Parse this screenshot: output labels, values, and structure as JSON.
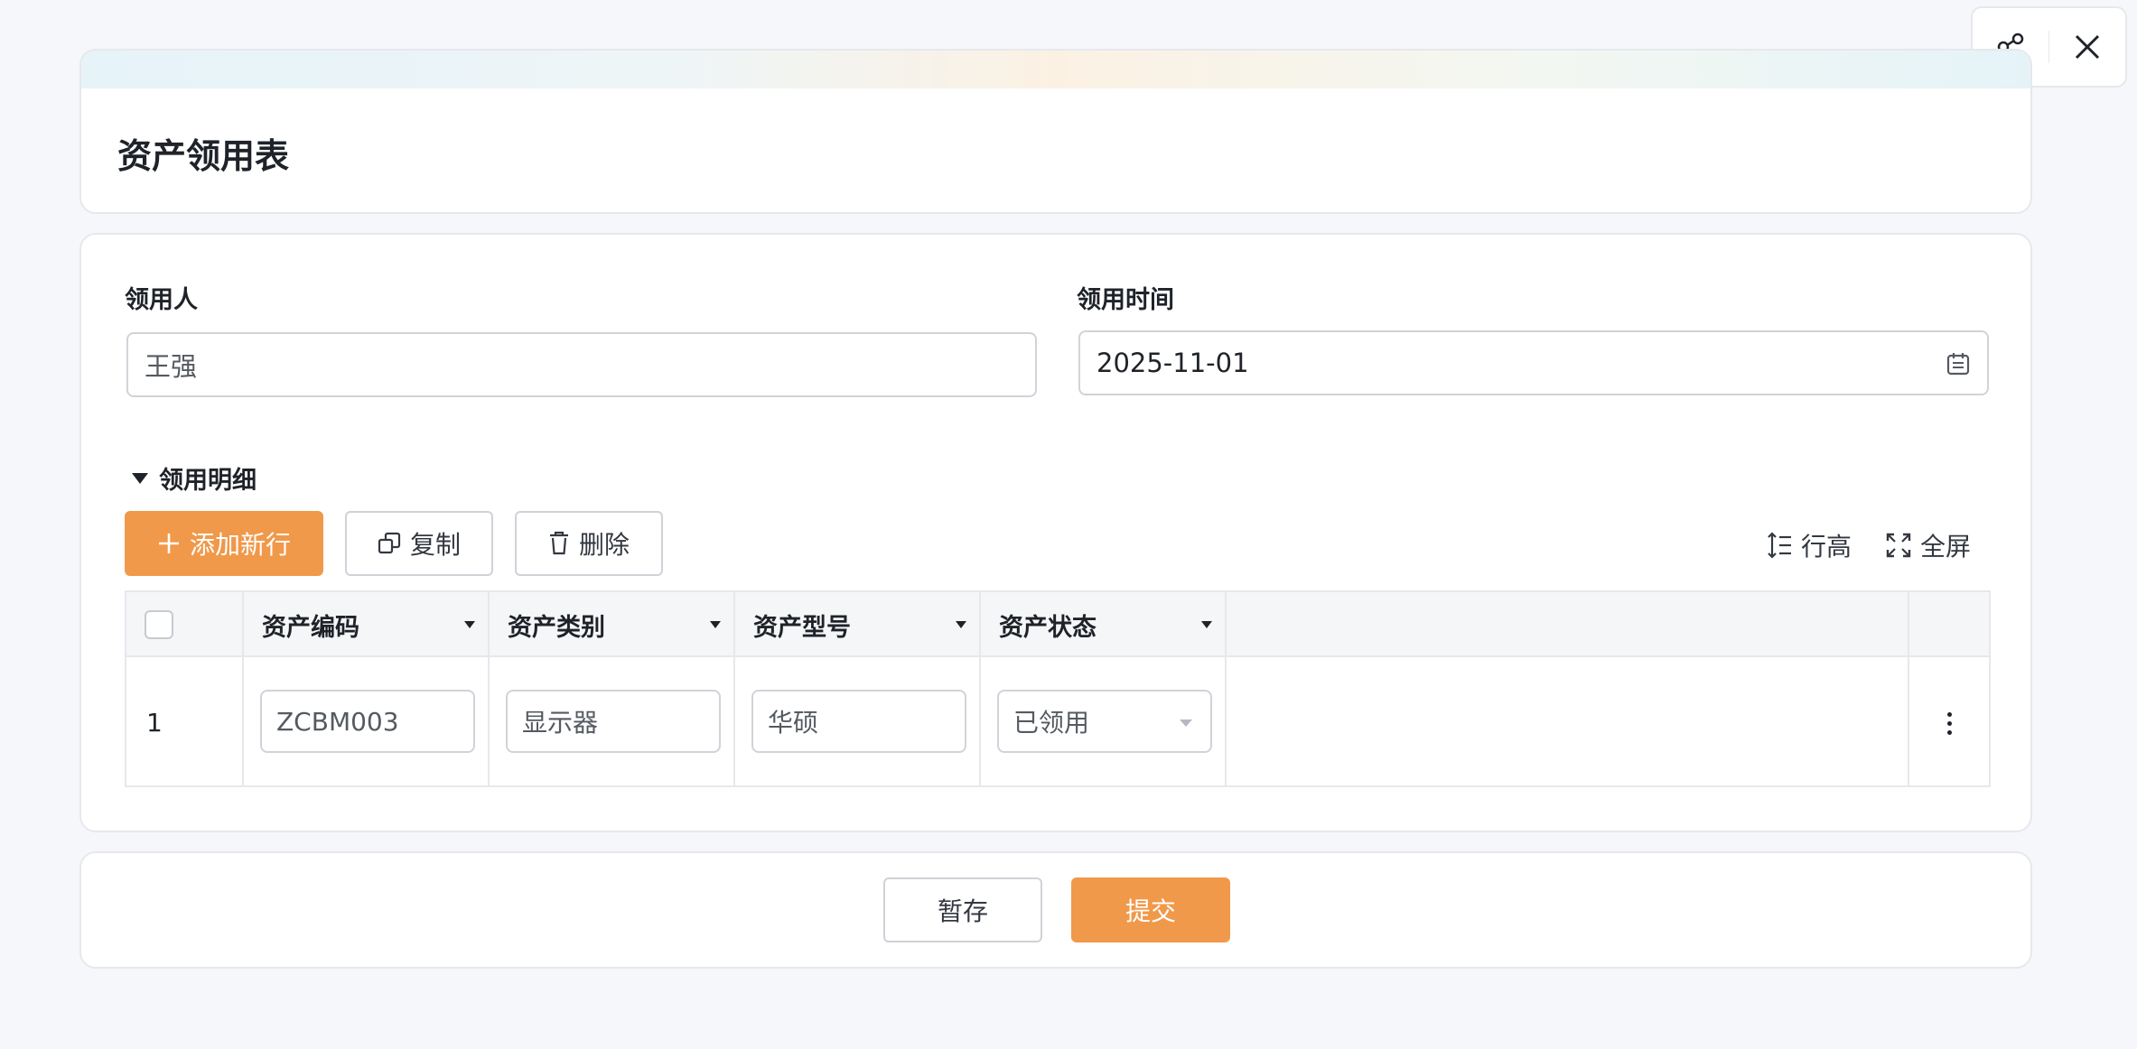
{
  "header": {
    "title": "资产领用表"
  },
  "float_actions": {
    "share_icon": "share-icon",
    "close_icon": "close-icon"
  },
  "form": {
    "recipient": {
      "label": "领用人",
      "value": "王强"
    },
    "date": {
      "label": "领用时间",
      "value": "2025-11-01"
    }
  },
  "details": {
    "section_label": "领用明细",
    "toolbar": {
      "add_label": "添加新行",
      "copy_label": "复制",
      "delete_label": "删除",
      "row_height_label": "行高",
      "fullscreen_label": "全屏"
    },
    "columns": [
      "资产编码",
      "资产类别",
      "资产型号",
      "资产状态"
    ],
    "rows": [
      {
        "index": "1",
        "code": "ZCBM003",
        "category": "显示器",
        "model": "华硕",
        "status": "已领用"
      }
    ]
  },
  "footer": {
    "draft_label": "暂存",
    "submit_label": "提交"
  },
  "colors": {
    "accent": "#f0994a",
    "border": "#e6e8ec",
    "background": "#f6f7fa"
  }
}
